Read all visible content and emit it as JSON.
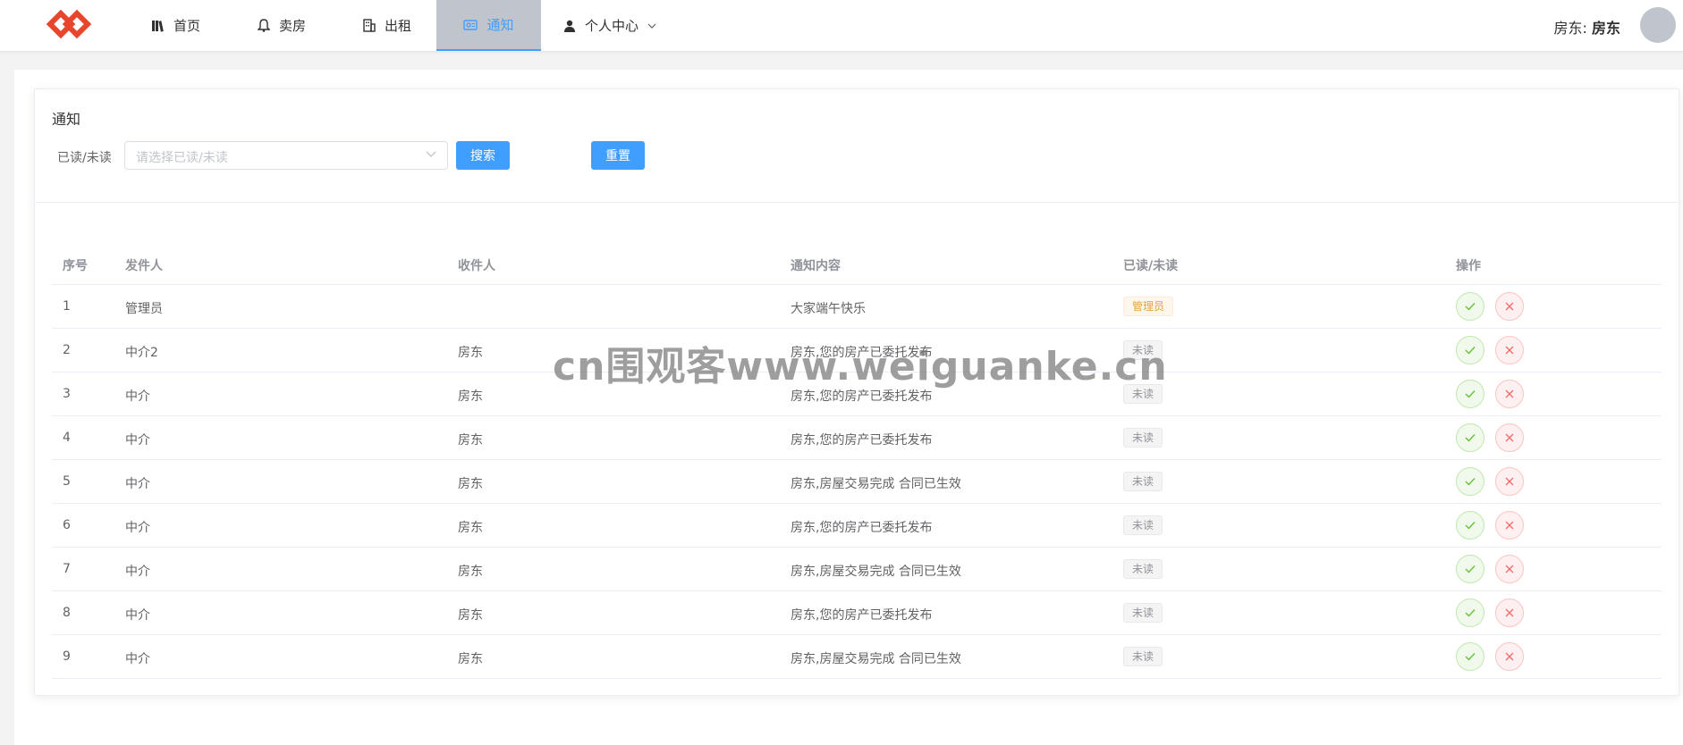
{
  "header": {
    "nav": [
      {
        "label": "首页",
        "icon": "books-icon"
      },
      {
        "label": "卖房",
        "icon": "bell-icon"
      },
      {
        "label": "出租",
        "icon": "building-icon"
      },
      {
        "label": "通知",
        "icon": "notice-icon"
      },
      {
        "label": "个人中心",
        "icon": "user-icon"
      }
    ],
    "user_prefix": "房东:",
    "user_name": "房东"
  },
  "card": {
    "title": "通知",
    "filter_label": "已读/未读",
    "select_placeholder": "请选择已读/未读",
    "search_label": "搜索",
    "reset_label": "重置"
  },
  "table": {
    "columns": [
      "序号",
      "发件人",
      "收件人",
      "通知内容",
      "已读/未读",
      "操作"
    ],
    "rows": [
      {
        "no": "1",
        "from": "管理员",
        "to": "",
        "content": "大家端午快乐",
        "status": "管理员"
      },
      {
        "no": "2",
        "from": "中介2",
        "to": "房东",
        "content": "房东,您的房产已委托发布",
        "status": "未读"
      },
      {
        "no": "3",
        "from": "中介",
        "to": "房东",
        "content": "房东,您的房产已委托发布",
        "status": "未读"
      },
      {
        "no": "4",
        "from": "中介",
        "to": "房东",
        "content": "房东,您的房产已委托发布",
        "status": "未读"
      },
      {
        "no": "5",
        "from": "中介",
        "to": "房东",
        "content": "房东,房屋交易完成 合同已生效",
        "status": "未读"
      },
      {
        "no": "6",
        "from": "中介",
        "to": "房东",
        "content": "房东,您的房产已委托发布",
        "status": "未读"
      },
      {
        "no": "7",
        "from": "中介",
        "to": "房东",
        "content": "房东,房屋交易完成 合同已生效",
        "status": "未读"
      },
      {
        "no": "8",
        "from": "中介",
        "to": "房东",
        "content": "房东,您的房产已委托发布",
        "status": "未读"
      },
      {
        "no": "9",
        "from": "中介",
        "to": "房东",
        "content": "房东,房屋交易完成 合同已生效",
        "status": "未读"
      }
    ]
  },
  "watermark": "cn围观客www.weiguanke.cn",
  "colors": {
    "primary": "#409eff",
    "success": "#67c23a",
    "danger": "#f56c6c",
    "warning": "#e6a23c",
    "logo": "#e8462c"
  }
}
